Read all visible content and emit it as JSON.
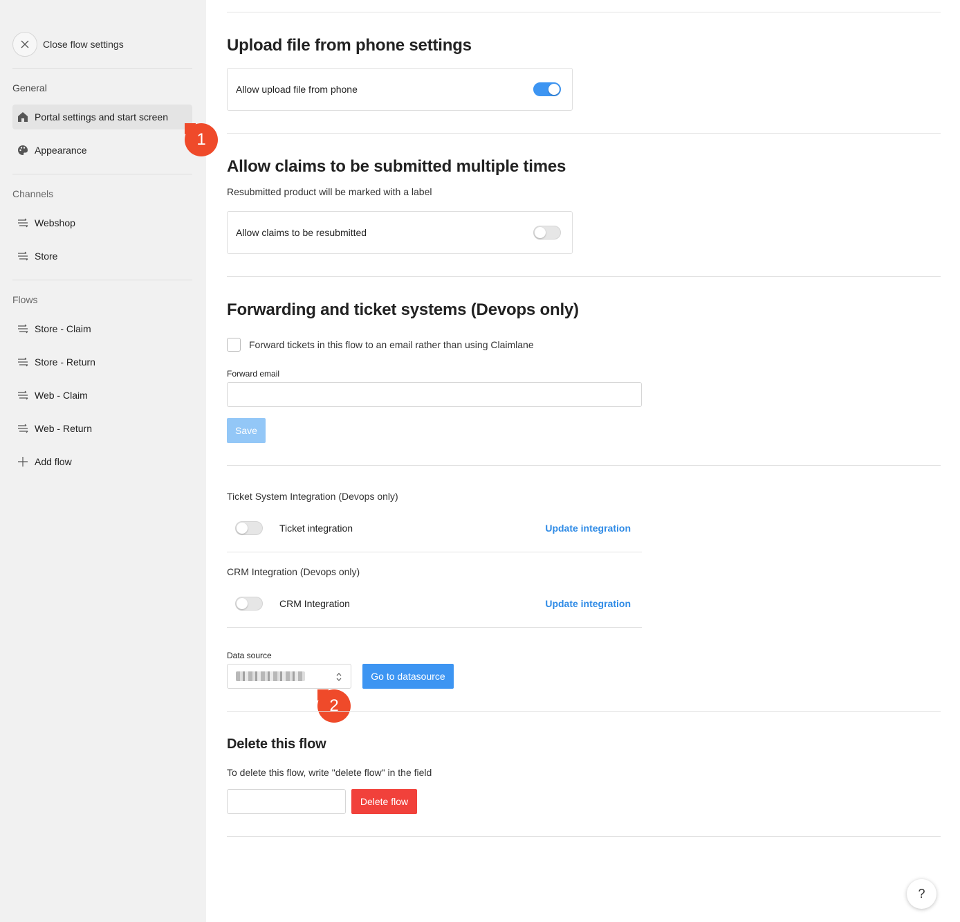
{
  "sidebar": {
    "close_label": "Close flow settings",
    "general_label": "General",
    "general_items": [
      {
        "label": "Portal settings and start screen",
        "icon": "home-icon",
        "active": true
      },
      {
        "label": "Appearance",
        "icon": "palette-icon",
        "active": false
      }
    ],
    "channels_label": "Channels",
    "channels_items": [
      {
        "label": "Webshop",
        "icon": "flow-icon"
      },
      {
        "label": "Store",
        "icon": "flow-icon"
      }
    ],
    "flows_label": "Flows",
    "flows_items": [
      {
        "label": "Store - Claim",
        "icon": "flow-icon"
      },
      {
        "label": "Store - Return",
        "icon": "flow-icon"
      },
      {
        "label": "Web - Claim",
        "icon": "flow-icon"
      },
      {
        "label": "Web - Return",
        "icon": "flow-icon"
      },
      {
        "label": "Add flow",
        "icon": "plus-icon"
      }
    ]
  },
  "annotations": {
    "badge1": "1",
    "badge2": "2"
  },
  "upload": {
    "title": "Upload file from phone settings",
    "toggle_label": "Allow upload file from phone",
    "toggle_on": true
  },
  "resubmit": {
    "title": "Allow claims to be submitted multiple times",
    "description": "Resubmitted product will be marked with a label",
    "toggle_label": "Allow claims to be resubmitted",
    "toggle_on": false
  },
  "forwarding": {
    "title": "Forwarding and ticket systems (Devops only)",
    "checkbox_label": "Forward tickets in this flow to an email rather than using Claimlane",
    "email_label": "Forward email",
    "email_value": "",
    "save_label": "Save"
  },
  "ticket_integration": {
    "title": "Ticket System Integration (Devops only)",
    "label": "Ticket integration",
    "link": "Update integration"
  },
  "crm_integration": {
    "title": "CRM Integration (Devops only)",
    "label": "CRM Integration",
    "link": "Update integration"
  },
  "datasource": {
    "label": "Data source",
    "button": "Go to datasource"
  },
  "delete": {
    "title": "Delete this flow",
    "description": "To delete this flow, write \"delete flow\" in the field",
    "input_value": "",
    "button": "Delete flow"
  },
  "help_label": "?",
  "colors": {
    "accent": "#3d95f2",
    "danger": "#f1413b",
    "badge": "#ef4a2a"
  }
}
